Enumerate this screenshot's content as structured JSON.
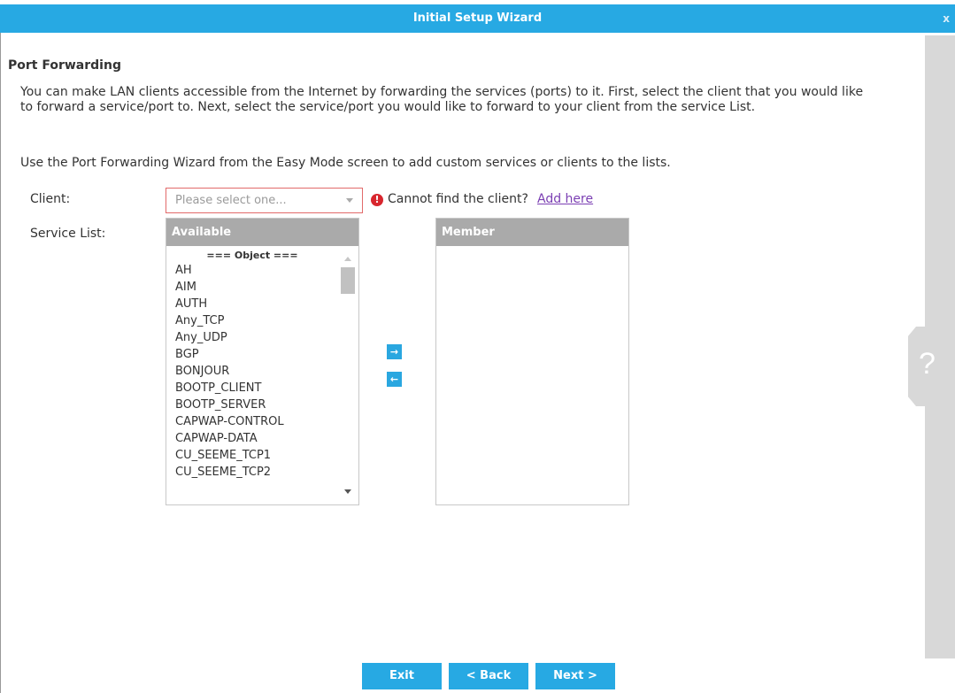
{
  "window": {
    "title": "Initial Setup Wizard",
    "close_glyph": "x"
  },
  "section": {
    "title": "Port Forwarding",
    "description": "You can make LAN clients accessible from the Internet by forwarding the services (ports) to it. First, select the client that you would like to forward a service/port to. Next, select the service/port you would like to forward to your client from the service List.",
    "note": "Use the Port Forwarding Wizard from the Easy Mode screen to add custom services or clients to the lists."
  },
  "client": {
    "label": "Client:",
    "placeholder": "Please select one...",
    "warning_text": "Cannot find the client?",
    "add_link": "Add here"
  },
  "service_list": {
    "label": "Service List:",
    "available_header": "Available",
    "member_header": "Member",
    "available_group": "=== Object ===",
    "available_items": [
      "AH",
      "AIM",
      "AUTH",
      "Any_TCP",
      "Any_UDP",
      "BGP",
      "BONJOUR",
      "BOOTP_CLIENT",
      "BOOTP_SERVER",
      "CAPWAP-CONTROL",
      "CAPWAP-DATA",
      "CU_SEEME_TCP1",
      "CU_SEEME_TCP2"
    ],
    "member_items": []
  },
  "icons": {
    "move_right": "arrow-right-icon",
    "move_left": "arrow-left-icon",
    "warning": "exclamation-icon",
    "help": "question-icon"
  },
  "buttons": {
    "exit": "Exit",
    "back": "< Back",
    "next": "Next >"
  },
  "colors": {
    "accent": "#27a9e3",
    "warning": "#d8262e",
    "link": "#7b3fb3"
  }
}
